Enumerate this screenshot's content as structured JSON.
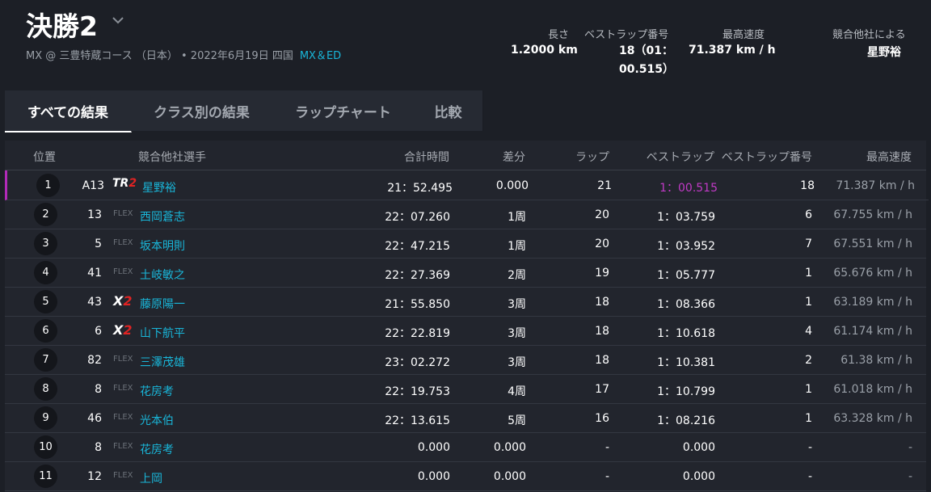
{
  "header": {
    "title": "決勝2",
    "subtitle_main": "MX @ 三豊特蔵コース （日本） • 2022年6月19日 四国",
    "subtitle_link": "MX＆ED",
    "stats": [
      {
        "label": "長さ",
        "value": "1.2000 km"
      },
      {
        "label": "ベストラップ番号",
        "value": "18（01：00.515）"
      },
      {
        "label": "最高速度",
        "value": "71.387 km / h"
      },
      {
        "label": "競合他社による",
        "value": "星野裕"
      }
    ]
  },
  "tabs": [
    {
      "label": "すべての結果",
      "active": true
    },
    {
      "label": "クラス別の結果",
      "active": false
    },
    {
      "label": "ラップチャート",
      "active": false
    },
    {
      "label": "比較",
      "active": false
    }
  ],
  "table": {
    "headers": {
      "position": "位置",
      "competitor": "競合他社選手",
      "total_time": "合計時間",
      "gap": "差分",
      "laps": "ラップ",
      "best_lap": "ベストラップ",
      "best_lap_no": "ベストラップ番号",
      "top_speed": "最高速度"
    },
    "rows": [
      {
        "pos": "1",
        "num": "A13",
        "logo": "TR2",
        "name": "星野裕",
        "total": "21：52.495",
        "gap": "0.000",
        "laps": "21",
        "best": "1：00.515",
        "best_no": "18",
        "speed": "71.387 km / h"
      },
      {
        "pos": "2",
        "num": "13",
        "logo": "FLEX",
        "name": "西岡蒼志",
        "total": "22：07.260",
        "gap": "1周",
        "laps": "20",
        "best": "1：03.759",
        "best_no": "6",
        "speed": "67.755 km / h"
      },
      {
        "pos": "3",
        "num": "5",
        "logo": "FLEX",
        "name": "坂本明則",
        "total": "22：47.215",
        "gap": "1周",
        "laps": "20",
        "best": "1：03.952",
        "best_no": "7",
        "speed": "67.551 km / h"
      },
      {
        "pos": "4",
        "num": "41",
        "logo": "FLEX",
        "name": "土岐敏之",
        "total": "22：27.369",
        "gap": "2周",
        "laps": "19",
        "best": "1：05.777",
        "best_no": "1",
        "speed": "65.676 km / h"
      },
      {
        "pos": "5",
        "num": "43",
        "logo": "X2",
        "name": "藤原陽一",
        "total": "21：55.850",
        "gap": "3周",
        "laps": "18",
        "best": "1：08.366",
        "best_no": "1",
        "speed": "63.189 km / h"
      },
      {
        "pos": "6",
        "num": "6",
        "logo": "X2",
        "name": "山下航平",
        "total": "22：22.819",
        "gap": "3周",
        "laps": "18",
        "best": "1：10.618",
        "best_no": "4",
        "speed": "61.174 km / h"
      },
      {
        "pos": "7",
        "num": "82",
        "logo": "FLEX",
        "name": "三澤茂雄",
        "total": "23：02.272",
        "gap": "3周",
        "laps": "18",
        "best": "1：10.381",
        "best_no": "2",
        "speed": "61.38 km / h"
      },
      {
        "pos": "8",
        "num": "8",
        "logo": "FLEX",
        "name": "花房考",
        "total": "22：19.753",
        "gap": "4周",
        "laps": "17",
        "best": "1：10.799",
        "best_no": "1",
        "speed": "61.018 km / h"
      },
      {
        "pos": "9",
        "num": "46",
        "logo": "FLEX",
        "name": "光本伯",
        "total": "22：13.615",
        "gap": "5周",
        "laps": "16",
        "best": "1：08.216",
        "best_no": "1",
        "speed": "63.328 km / h"
      },
      {
        "pos": "10",
        "num": "8",
        "logo": "FLEX",
        "name": "花房考",
        "total": "0.000",
        "gap": "0.000",
        "laps": "-",
        "best": "0.000",
        "best_no": "-",
        "speed": "-"
      },
      {
        "pos": "11",
        "num": "12",
        "logo": "FLEX",
        "name": "上岡",
        "total": "0.000",
        "gap": "0.000",
        "laps": "-",
        "best": "0.000",
        "best_no": "-",
        "speed": "-"
      }
    ]
  },
  "colors": {
    "background": "#1c1f26",
    "table_bg": "#22252d",
    "accent_link": "#19b6d9",
    "best_lap_purple": "#c13ac6",
    "leader_marker": "#b12ab8"
  }
}
